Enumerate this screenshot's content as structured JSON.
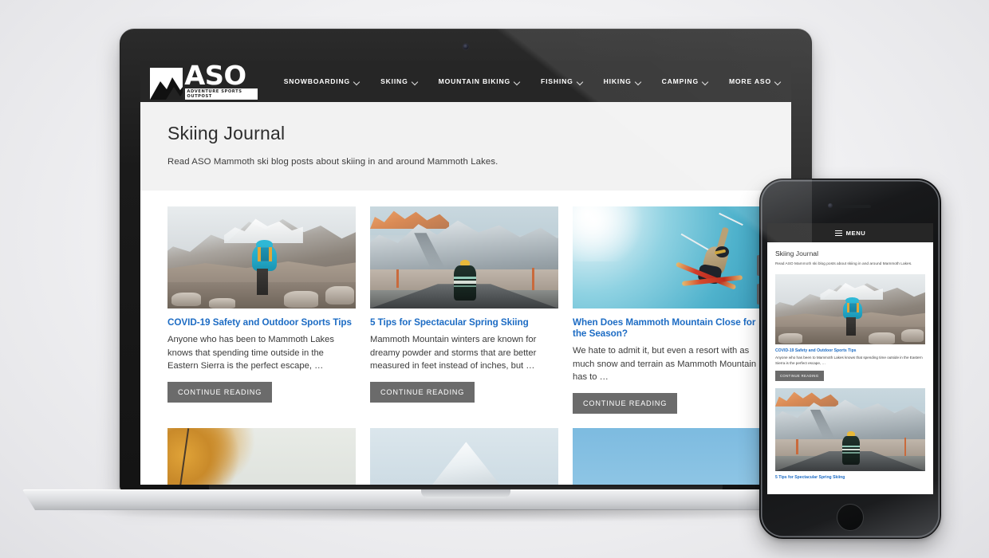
{
  "site": {
    "logo": {
      "mark": "mountain-logo-icon",
      "name": "ASO",
      "tagline": "ADVENTURE SPORTS OUTPOST"
    },
    "nav": [
      {
        "label": "SNOWBOARDING",
        "has_dropdown": true
      },
      {
        "label": "SKIING",
        "has_dropdown": true
      },
      {
        "label": "MOUNTAIN BIKING",
        "has_dropdown": true
      },
      {
        "label": "FISHING",
        "has_dropdown": true
      },
      {
        "label": "HIKING",
        "has_dropdown": true
      },
      {
        "label": "CAMPING",
        "has_dropdown": true
      },
      {
        "label": "MORE ASO",
        "has_dropdown": true
      }
    ],
    "page": {
      "title": "Skiing Journal",
      "subtitle": "Read ASO Mammoth ski blog posts about skiing in and around Mammoth Lakes."
    },
    "posts": [
      {
        "title": "COVID-19 Safety and Outdoor Sports Tips",
        "excerpt": "Anyone who has been to Mammoth Lakes knows that spending time outside in the Eastern Sierra is the perfect escape, …",
        "button": "CONTINUE READING",
        "image": "hiker-snowy-mountain-photo"
      },
      {
        "title": "5 Tips for Spectacular Spring Skiing",
        "excerpt": "Mammoth Mountain winters are known for dreamy powder and storms that are better measured in feet instead of inches, but …",
        "button": "CONTINUE READING",
        "image": "person-on-road-snowy-mountain-photo"
      },
      {
        "title": "When Does Mammoth Mountain Close for the Season?",
        "excerpt": "We hate to admit it, but even a resort with as much snow and terrain as Mammoth Mountain has to …",
        "button": "CONTINUE READING",
        "image": "skier-jumping-blue-sky-photo"
      }
    ],
    "posts_row2": [
      {
        "image": "autumn-tree-photo"
      },
      {
        "image": "snowy-peak-photo"
      },
      {
        "image": "blue-sky-photo"
      }
    ]
  },
  "mobile": {
    "menu_label": "MENU",
    "page": {
      "title": "Skiing Journal",
      "subtitle": "Read ASO Mammoth ski blog posts about skiing in and around Mammoth Lakes."
    },
    "posts": [
      {
        "title": "COVID-19 Safety and Outdoor Sports Tips",
        "excerpt": "Anyone who has been to Mammoth Lakes knows that spending time outside in the Eastern Sierra is the perfect escape, …",
        "button": "CONTINUE READING"
      },
      {
        "title": "5 Tips for Spectacular Spring Skiing"
      }
    ]
  },
  "colors": {
    "nav_bar": "#262626",
    "link_blue": "#1d6cc4",
    "button_gray": "#6b6b6b",
    "page_head_gray": "#f2f2f2",
    "page_background": "#f1f1f3"
  }
}
